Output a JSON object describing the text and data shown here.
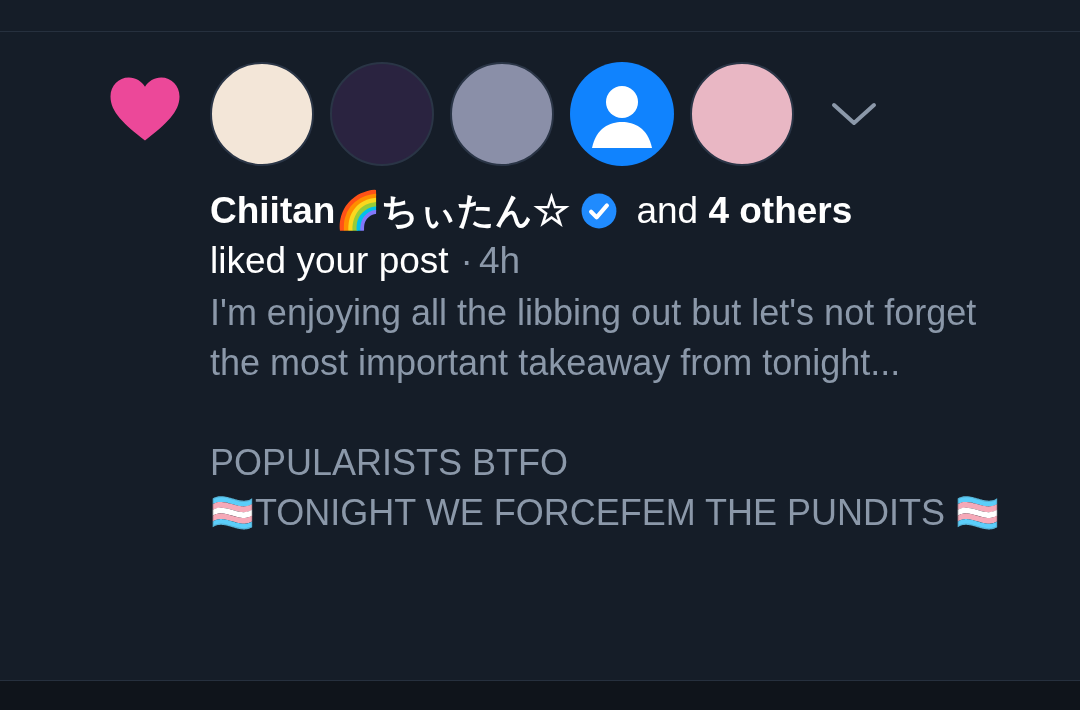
{
  "notification": {
    "avatars": [
      {
        "kind": "photo",
        "color": "#f3e6d8"
      },
      {
        "kind": "photo",
        "color": "#2a2340"
      },
      {
        "kind": "photo",
        "color": "#8a8fa8"
      },
      {
        "kind": "default",
        "color": "#1083fe"
      },
      {
        "kind": "photo",
        "color": "#e9b7c4"
      }
    ],
    "author": "Chiitan🌈ちぃたん☆",
    "verified": true,
    "others": "and **4 others**",
    "action": "liked your post",
    "separator": "·",
    "time": "4h",
    "post_text": "I'm enjoying all the libbing out but let's not forget the most important takeaway from tonight...\n\nPOPULARISTS BTFO\n🏳️‍⚧️TONIGHT WE FORCEFEM THE PUNDITS 🏳️‍⚧️"
  }
}
